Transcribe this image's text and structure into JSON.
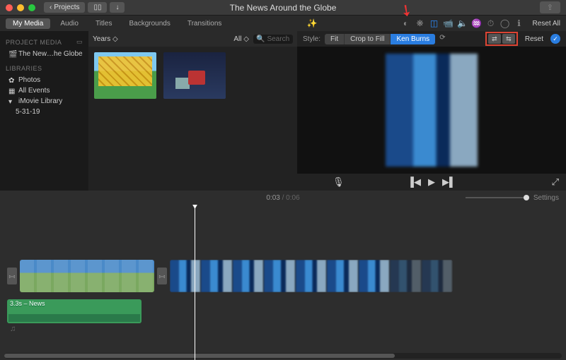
{
  "titlebar": {
    "projects_label": "Projects",
    "title": "The News Around the Globe"
  },
  "media_tabs": [
    "My Media",
    "Audio",
    "Titles",
    "Backgrounds",
    "Transitions"
  ],
  "sidebar": {
    "heading1": "PROJECT MEDIA",
    "project_name": "The New…he Globe",
    "heading2": "LIBRARIES",
    "items": [
      "Photos",
      "All Events",
      "iMovie Library"
    ],
    "sub": "5-31-19"
  },
  "browser": {
    "years_label": "Years",
    "all_label": "All",
    "search_placeholder": "Search"
  },
  "viewer_toolbar": {
    "reset_all": "Reset All"
  },
  "style_row": {
    "label": "Style:",
    "options": [
      "Fit",
      "Crop to Fill",
      "Ken Burns"
    ],
    "reset": "Reset"
  },
  "viewer": {
    "mic": "🎤"
  },
  "timeline": {
    "time_current": "0:03",
    "time_total": "0:06",
    "settings_label": "Settings",
    "audio_label": "3.3s – News"
  }
}
